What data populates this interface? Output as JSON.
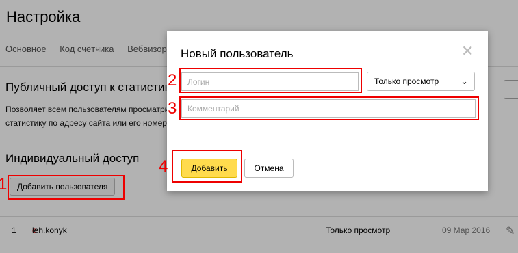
{
  "page": {
    "title": "Настройка",
    "tabs": [
      "Основное",
      "Код счётчика",
      "Вебвизор"
    ],
    "public_access": {
      "title": "Публичный доступ к статистике",
      "description": "Позволяет всем пользователям просматривать статистику по адресу сайта или его номеру"
    },
    "individual_access": {
      "title": "Индивидуальный доступ",
      "add_user_button": "Добавить пользователя"
    },
    "users_table": {
      "rows": [
        {
          "index": "1",
          "login_first": "o",
          "login_rest": "leh.konyk",
          "permission": "Только просмотр",
          "date": "09 Мар 2016"
        }
      ]
    }
  },
  "modal": {
    "title": "Новый пользователь",
    "login_placeholder": "Логин",
    "permission_selected": "Только просмотр",
    "comment_placeholder": "Комментарий",
    "add_button": "Добавить",
    "cancel_button": "Отмена"
  },
  "annotations": {
    "colors": {
      "accent": "#e00000",
      "primary_button": "#ffdb4d"
    },
    "labels": [
      "1",
      "2",
      "3",
      "4"
    ]
  },
  "icons": {
    "close": "close-icon",
    "chevron": "chevron-down-icon",
    "edit": "pencil-icon"
  }
}
